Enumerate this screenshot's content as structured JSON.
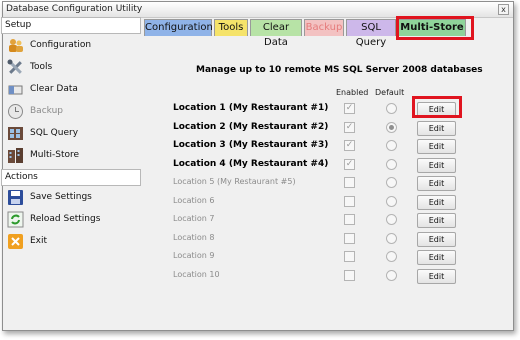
{
  "window": {
    "title": "Database Configuration Utility",
    "close_label": "x"
  },
  "sidebar": {
    "setup_header": "Setup",
    "setup_items": [
      {
        "label": "Configuration",
        "icon": "people-icon",
        "enabled": true
      },
      {
        "label": "Tools",
        "icon": "tools-icon",
        "enabled": true
      },
      {
        "label": "Clear Data",
        "icon": "eraser-icon",
        "enabled": true
      },
      {
        "label": "Backup",
        "icon": "clock-icon",
        "enabled": false
      },
      {
        "label": "SQL Query",
        "icon": "database-icon",
        "enabled": true
      },
      {
        "label": "Multi-Store",
        "icon": "buildings-icon",
        "enabled": true
      }
    ],
    "actions_header": "Actions",
    "action_items": [
      {
        "label": "Save Settings",
        "icon": "save-icon"
      },
      {
        "label": "Reload Settings",
        "icon": "reload-icon"
      },
      {
        "label": "Exit",
        "icon": "exit-icon"
      }
    ]
  },
  "tabs": [
    {
      "label": "Configuration",
      "color": "#8fb3e8",
      "state": "normal"
    },
    {
      "label": "Tools",
      "color": "#f5e36a",
      "state": "normal"
    },
    {
      "label": "Clear Data",
      "color": "#b7e3a6",
      "state": "normal"
    },
    {
      "label": "Backup",
      "color": "#f3c2c2",
      "state": "disabled"
    },
    {
      "label": "SQL Query",
      "color": "#cdb8ea",
      "state": "normal"
    },
    {
      "label": "Multi-Store",
      "color": "#8fd49a",
      "state": "active"
    }
  ],
  "main": {
    "heading": "Manage up to 10 remote MS SQL Server 2008 databases",
    "enabled_header": "Enabled",
    "default_header": "Default",
    "edit_label": "Edit",
    "locations": [
      {
        "label": "Location 1 (My Restaurant #1)",
        "enabled": true,
        "default": false,
        "active": true
      },
      {
        "label": "Location 2 (My Restaurant #2)",
        "enabled": true,
        "default": true,
        "active": true
      },
      {
        "label": "Location 3 (My Restaurant #3)",
        "enabled": true,
        "default": false,
        "active": true
      },
      {
        "label": "Location 4 (My Restaurant #4)",
        "enabled": true,
        "default": false,
        "active": true
      },
      {
        "label": "Location 5 (My Restaurant #5)",
        "enabled": false,
        "default": false,
        "active": false
      },
      {
        "label": "Location 6",
        "enabled": false,
        "default": false,
        "active": false
      },
      {
        "label": "Location 7",
        "enabled": false,
        "default": false,
        "active": false
      },
      {
        "label": "Location 8",
        "enabled": false,
        "default": false,
        "active": false
      },
      {
        "label": "Location 9",
        "enabled": false,
        "default": false,
        "active": false
      },
      {
        "label": "Location 10",
        "enabled": false,
        "default": false,
        "active": false
      }
    ]
  },
  "colors": {
    "highlight": "#e0141f",
    "window_bg": "#f0f0f0"
  }
}
